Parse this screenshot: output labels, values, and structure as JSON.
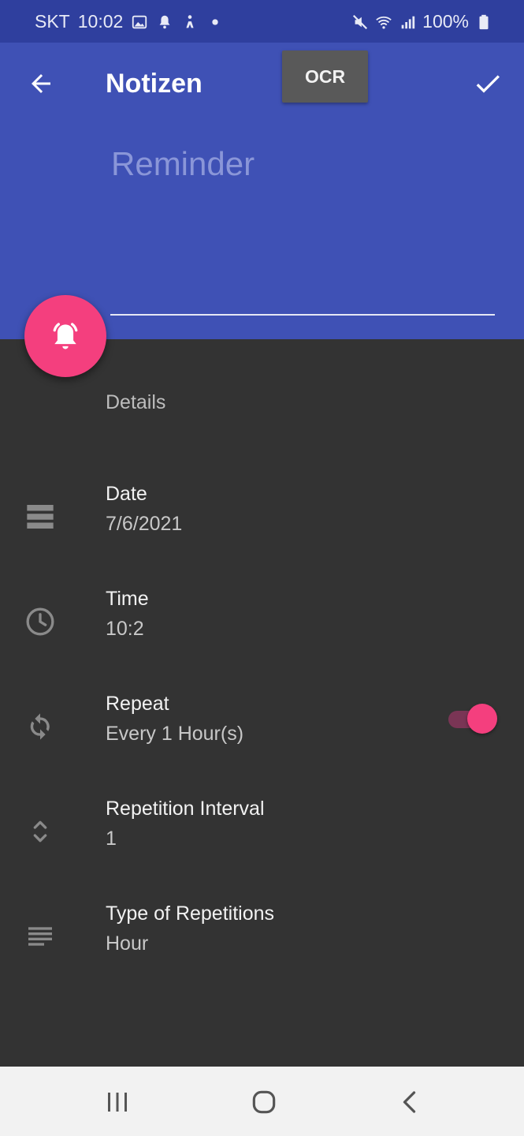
{
  "status_bar": {
    "carrier": "SKT",
    "time": "10:02",
    "battery": "100%",
    "icons_left": [
      "gallery-icon",
      "notification-bell-icon",
      "accessibility-icon",
      "dot-icon"
    ],
    "icons_right": [
      "mute-icon",
      "wifi-icon",
      "signal-icon",
      "battery-icon"
    ]
  },
  "app_bar": {
    "title": "Notizen",
    "ocr_label": "OCR",
    "back_icon": "arrow-back-icon",
    "confirm_icon": "check-icon"
  },
  "editor": {
    "title_placeholder": "Reminder"
  },
  "fab": {
    "icon": "alarm-bell-icon"
  },
  "details": {
    "section_label": "Details",
    "rows": [
      {
        "label": "Date",
        "value": "7/6/2021",
        "icon": "calendar-icon"
      },
      {
        "label": "Time",
        "value": "10:2",
        "icon": "clock-icon"
      },
      {
        "label": "Repeat",
        "value": "Every 1 Hour(s)",
        "icon": "repeat-icon"
      },
      {
        "label": "Repetition Interval",
        "value": "1",
        "icon": "unfold-icon"
      },
      {
        "label": "Type of Repetitions",
        "value": "Hour",
        "icon": "list-icon"
      }
    ],
    "repeat_enabled": true
  },
  "colors": {
    "primary": "#3f51b5",
    "primary_dark": "#2f3f9e",
    "accent": "#f43f7e",
    "background": "#333333"
  },
  "nav_bar": {
    "buttons": [
      "recents-icon",
      "home-icon",
      "back-icon"
    ]
  }
}
